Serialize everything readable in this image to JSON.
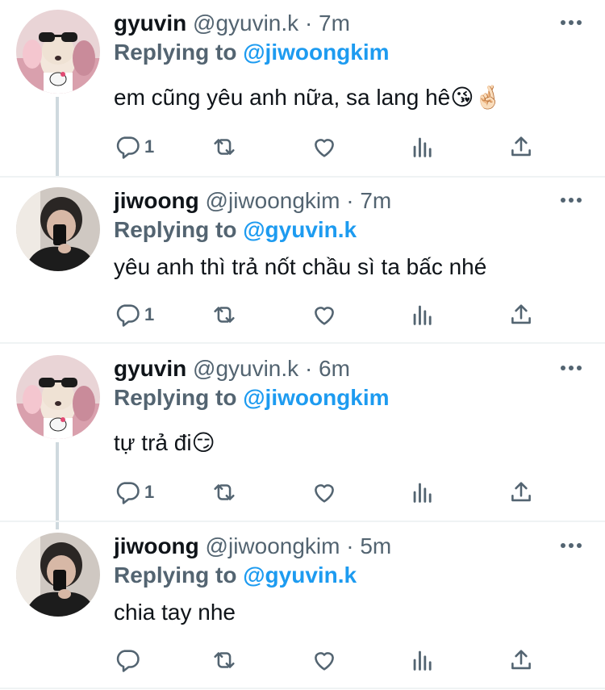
{
  "tweets": [
    {
      "name": "gyuvin",
      "handle": "@gyuvin.k",
      "dot": "·",
      "time": "7m",
      "reply_prefix": "Replying to",
      "reply_to": "@jiwoongkim",
      "text": "em cũng yêu anh nữa, sa lang hê😘🤞🏻",
      "reply_count": "1",
      "avatar": "gyuvin-avatar"
    },
    {
      "name": "jiwoong",
      "handle": "@jiwoongkim",
      "dot": "·",
      "time": "7m",
      "reply_prefix": "Replying to",
      "reply_to": "@gyuvin.k",
      "text": "yêu anh thì trả nốt chầu sì ta bấc nhé",
      "reply_count": "1",
      "avatar": "jiwoong-avatar"
    },
    {
      "name": "gyuvin",
      "handle": "@gyuvin.k",
      "dot": "·",
      "time": "6m",
      "reply_prefix": "Replying to",
      "reply_to": "@jiwoongkim",
      "text": "tự trả đi😏",
      "reply_count": "1",
      "avatar": "gyuvin-avatar"
    },
    {
      "name": "jiwoong",
      "handle": "@jiwoongkim",
      "dot": "·",
      "time": "5m",
      "reply_prefix": "Replying to",
      "reply_to": "@gyuvin.k",
      "text": "chia tay nhe",
      "reply_count": "",
      "avatar": "jiwoong-avatar"
    }
  ],
  "colors": {
    "accent": "#1d9bf0",
    "secondary": "#536471",
    "thread_line": "#cfd9de"
  }
}
